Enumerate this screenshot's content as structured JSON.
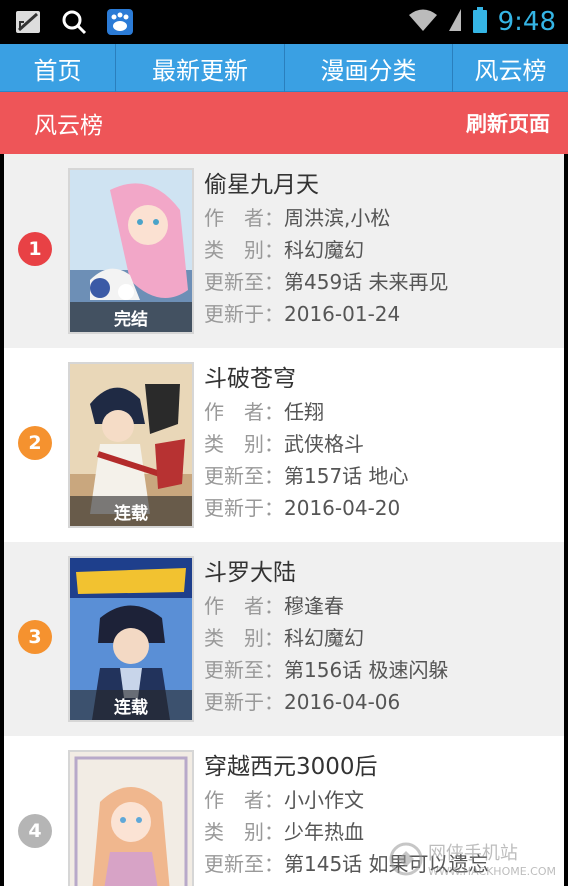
{
  "status_bar": {
    "time": "9:48",
    "icons": [
      "signal-off-icon",
      "search-icon",
      "baidu-paw-icon",
      "wifi-icon",
      "cell-signal-icon",
      "battery-icon"
    ],
    "time_color": "#35b5e5"
  },
  "nav": {
    "tabs": [
      {
        "label": "首页"
      },
      {
        "label": "最新更新"
      },
      {
        "label": "漫画分类"
      },
      {
        "label": "风云榜"
      }
    ],
    "color": "#3aa0e3"
  },
  "header": {
    "title": "风云榜",
    "refresh": "刷新页面",
    "color": "#ee5558"
  },
  "labels": {
    "author": "作　者：",
    "category": "类　别：",
    "updated_to": "更新至：",
    "updated_on": "更新于："
  },
  "items": [
    {
      "rank": "1",
      "rank_color": "#e84145",
      "title": "偷星九月天",
      "author": "周洪滨,小松",
      "category": "科幻魔幻",
      "latest": "第459话 未来再见",
      "date": "2016-01-24",
      "badge": "完结"
    },
    {
      "rank": "2",
      "rank_color": "#f5922f",
      "title": "斗破苍穹",
      "author": "任翔",
      "category": "武侠格斗",
      "latest": "第157话 地心",
      "date": "2016-04-20",
      "badge": "连载"
    },
    {
      "rank": "3",
      "rank_color": "#f5922f",
      "title": "斗罗大陆",
      "author": "穆逢春",
      "category": "科幻魔幻",
      "latest": "第156话 极速闪躲",
      "date": "2016-04-06",
      "badge": "连载"
    },
    {
      "rank": "4",
      "rank_color": "#b5b5b5",
      "title": "穿越西元3000后",
      "author": "小小作文",
      "category": "少年热血",
      "latest": "第145话 如果可以遗忘",
      "date": "",
      "badge": ""
    }
  ],
  "watermark": {
    "text": "网侠手机站",
    "sub": "WWW.HACKHOME.COM"
  }
}
